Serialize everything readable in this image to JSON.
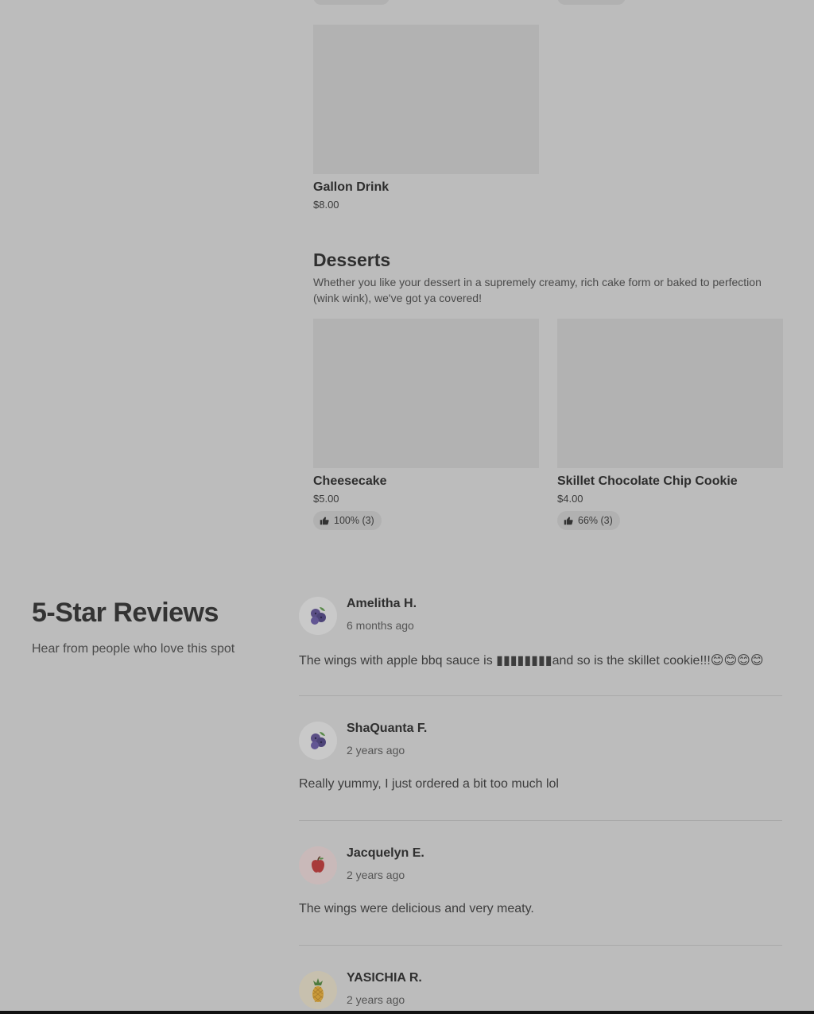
{
  "gallon_drink": {
    "name": "Gallon Drink",
    "price": "$8.00"
  },
  "desserts": {
    "title": "Desserts",
    "description": "Whether you like your dessert in a supremely creamy, rich cake form or baked to perfection (wink wink), we've got ya covered!",
    "items": [
      {
        "name": "Cheesecake",
        "price": "$5.00",
        "rating": "100% (3)"
      },
      {
        "name": "Skillet Chocolate Chip Cookie",
        "price": "$4.00",
        "rating": "66% (3)"
      }
    ]
  },
  "reviews": {
    "title": "5-Star Reviews",
    "subtitle": "Hear from people who love this spot",
    "items": [
      {
        "author": "Amelitha H.",
        "when": "6 months ago",
        "avatar": "blueberry-icon",
        "text": "The wings with apple bbq sauce is ▮▮▮▮▮▮▮▮and so is the skillet cookie!!!😊😊😊😊"
      },
      {
        "author": "ShaQuanta F.",
        "when": "2 years ago",
        "avatar": "blueberry-icon",
        "text": "Really yummy, I just ordered a bit too much lol"
      },
      {
        "author": "Jacquelyn E.",
        "when": "2 years ago",
        "avatar": "apple-icon",
        "text": "The wings were delicious and very meaty."
      },
      {
        "author": "YASICHIA R.",
        "when": "2 years ago",
        "avatar": "pineapple-icon",
        "text": ""
      }
    ]
  },
  "colors": {
    "background": "#bcbcbc",
    "placeholder": "#b2b2b2",
    "chip": "#b1b1b1"
  }
}
